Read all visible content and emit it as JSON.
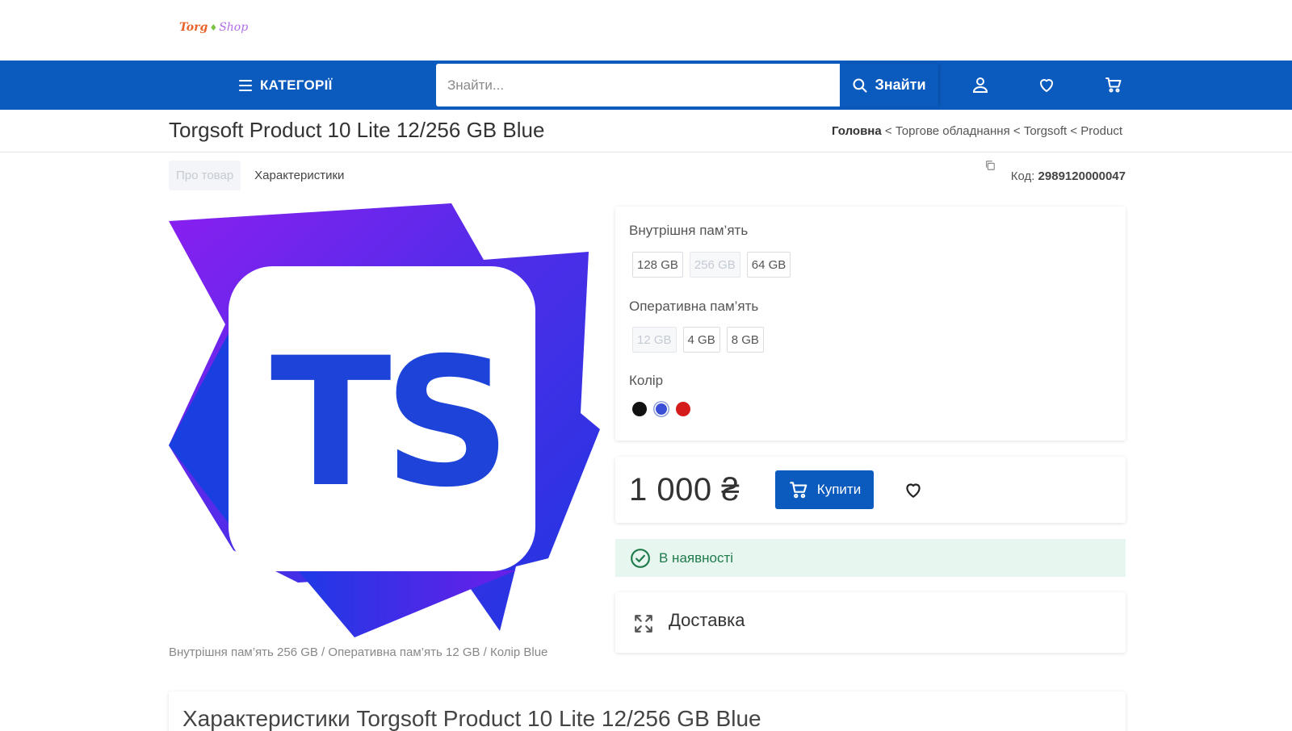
{
  "logo": {
    "part1": "Torg",
    "separator": "♦",
    "part2": "Shop"
  },
  "nav": {
    "categories_label": "КАТЕГОРІЇ",
    "search_placeholder": "Знайти...",
    "search_button": "Знайти"
  },
  "product": {
    "title": "Torgsoft Product 10 Lite 12/256 GB Blue",
    "code_label": "Код:",
    "code_value": "2989120000047",
    "variant_caption": "Внутрішня пам’ять 256 GB / Оперативна пам’ять 12 GB / Колір Blue",
    "image_text": "TS"
  },
  "breadcrumb": {
    "home": "Головна",
    "items": [
      "Торгове обладнання",
      "Torgsoft",
      "Product"
    ],
    "separator": " < "
  },
  "tabs": [
    {
      "label": "Про товар",
      "active": true
    },
    {
      "label": "Характеристики",
      "active": false
    }
  ],
  "options": {
    "storage": {
      "label": "Внутрішня пам’ять",
      "values": [
        "128 GB",
        "256 GB",
        "64 GB"
      ],
      "selected": "256 GB"
    },
    "ram": {
      "label": "Оперативна пам’ять",
      "values": [
        "12 GB",
        "4 GB",
        "8 GB"
      ],
      "selected": "12 GB"
    },
    "color": {
      "label": "Колір",
      "swatches": [
        "#111111",
        "#3a4fd6",
        "#d41a1a"
      ],
      "selected_index": 1
    }
  },
  "purchase": {
    "price": "1 000 ₴",
    "buy_label": "Купити"
  },
  "stock": {
    "label": "В наявності"
  },
  "delivery": {
    "label": "Доставка"
  },
  "specs": {
    "title": "Характеристики Torgsoft Product 10 Lite 12/256 GB Blue"
  },
  "colors": {
    "brand": "#0b5bbf",
    "stock_bg": "#e7f6ee",
    "stock_text": "#1f7a4c"
  }
}
